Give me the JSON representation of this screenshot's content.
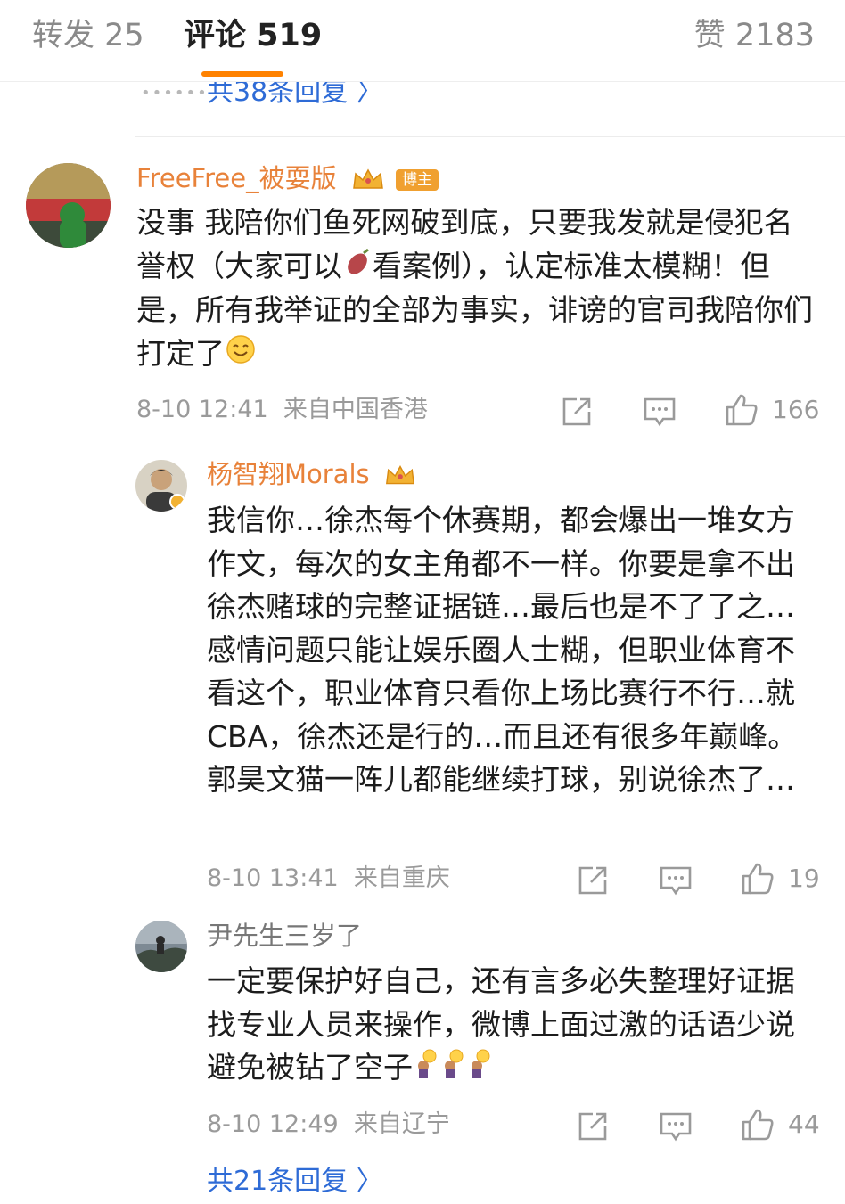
{
  "tabs": {
    "repost": "转发 25",
    "comments": "评论 519",
    "likes": "赞 2183"
  },
  "top_more_replies": "共38条回复 〉",
  "comments": [
    {
      "author": "FreeFree_被耍版",
      "author_badge": "博主",
      "text_before_emoji": "没事 我陪你们鱼死网破到底，只要我发就是侵犯名誉权（大家可以",
      "text_after_emoji": "看案例），认定标准太模糊！但是，所有我举证的全部为事实，诽谤的官司我陪你们打定了",
      "time": "8-10 12:41",
      "location": "来自中国香港",
      "likes": "166",
      "icons": [
        "share-icon",
        "comment-icon",
        "thumbs-up-icon"
      ]
    },
    {
      "author": "杨智翔Morals",
      "text": "我信你…徐杰每个休赛期，都会爆出一堆女方作文，每次的女主角都不一样。你要是拿不出徐杰赌球的完整证据链…最后也是不了了之…感情问题只能让娱乐圈人士糊，但职业体育不看这个，职业体育只看你上场比赛行不行…就CBA，徐杰还是行的…而且还有很多年巅峰。郭昊文猫一阵儿都能继续打球，别说徐杰了…",
      "time": "8-10 13:41",
      "location": "来自重庆",
      "likes": "19"
    },
    {
      "author": "尹先生三岁了",
      "text": "一定要保护好自己，还有言多必失整理好证据找专业人员来操作，微博上面过激的话语少说避免被钻了空子",
      "time": "8-10 12:49",
      "location": "来自辽宁",
      "likes": "44"
    }
  ],
  "bottom_more_replies": "共21条回复 〉",
  "colors": {
    "accent": "#ff8200",
    "link": "#2e6bd6",
    "author": "#e8823a",
    "meta": "#9a9a9a"
  }
}
